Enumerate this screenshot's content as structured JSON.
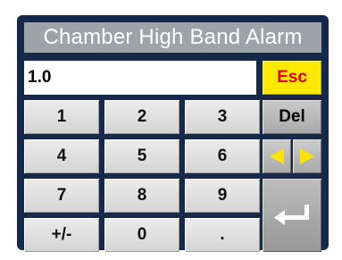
{
  "dialog": {
    "title": "Chamber High Band Alarm",
    "value": "1.0"
  },
  "keys": {
    "esc": "Esc",
    "del": "Del",
    "digits": [
      "1",
      "2",
      "3",
      "4",
      "5",
      "6",
      "7",
      "8",
      "9",
      "0"
    ],
    "plus_minus": "+/-",
    "decimal": "."
  },
  "icons": {
    "left": "left-arrow-icon",
    "right": "right-arrow-icon",
    "enter": "enter-return-icon"
  },
  "colors": {
    "panel": "#16294a",
    "title_bar": "#9ea3a8",
    "esc_bg": "#ffe800",
    "esc_text": "#e30000",
    "arrow": "#ffe400"
  }
}
